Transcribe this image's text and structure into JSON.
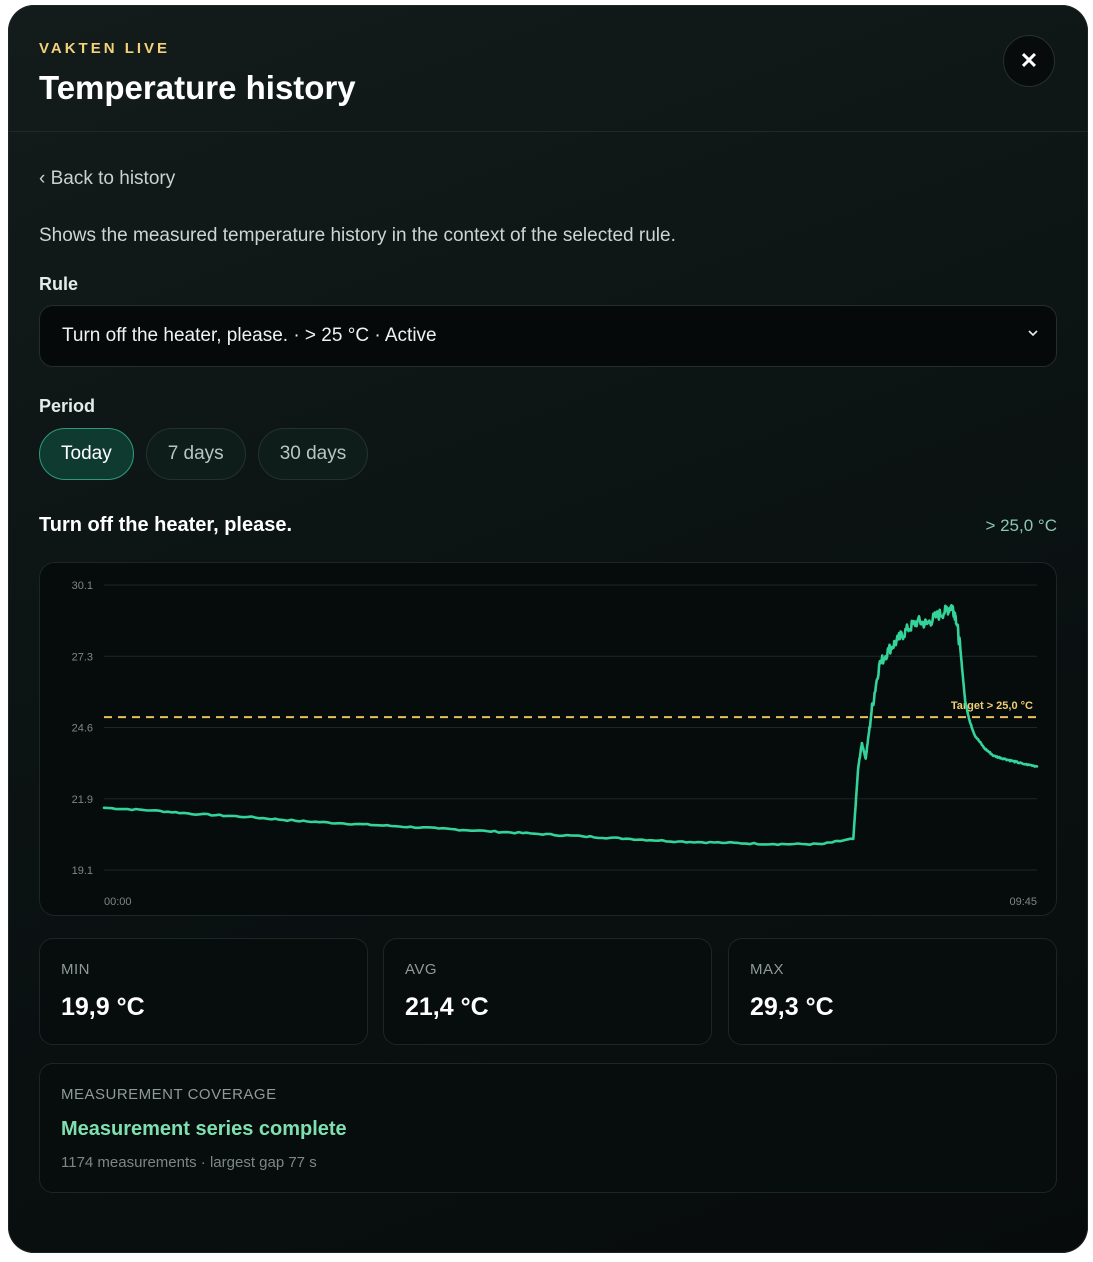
{
  "header": {
    "eyebrow": "VAKTEN LIVE",
    "title": "Temperature history",
    "close_symbol": "✕"
  },
  "back_link": "‹ Back to history",
  "description": "Shows the measured temperature history in the context of the selected rule.",
  "rule": {
    "label": "Rule",
    "selected": "Turn off the heater, please. · > 25 °C · Active"
  },
  "period": {
    "label": "Period",
    "options": [
      "Today",
      "7 days",
      "30 days"
    ],
    "active_index": 0
  },
  "chart_header": {
    "title": "Turn off the heater, please.",
    "target": "> 25,0 °C"
  },
  "chart_data": {
    "type": "line",
    "title": "",
    "x_tick_labels": [
      "00:00",
      "09:45"
    ],
    "x_range_hours": [
      0,
      9.75
    ],
    "y_ticks": [
      "30.1",
      "27.3",
      "24.6",
      "21.9",
      "19.1"
    ],
    "ylim": [
      19.1,
      30.1
    ],
    "grid": true,
    "threshold": {
      "value": 25.0,
      "label": "Target > 25,0 °C"
    },
    "series": [
      {
        "points_hours_celsius": [
          [
            0.0,
            21.5
          ],
          [
            0.5,
            21.4
          ],
          [
            1.0,
            21.25
          ],
          [
            1.5,
            21.15
          ],
          [
            2.0,
            21.0
          ],
          [
            2.5,
            20.9
          ],
          [
            3.0,
            20.8
          ],
          [
            3.5,
            20.7
          ],
          [
            4.0,
            20.6
          ],
          [
            4.5,
            20.5
          ],
          [
            5.0,
            20.4
          ],
          [
            5.5,
            20.3
          ],
          [
            6.0,
            20.2
          ],
          [
            6.5,
            20.15
          ],
          [
            7.0,
            20.1
          ],
          [
            7.5,
            20.1
          ],
          [
            7.83,
            20.3
          ],
          [
            7.88,
            23.0
          ],
          [
            7.92,
            24.0
          ],
          [
            7.96,
            23.4
          ],
          [
            8.02,
            25.2
          ],
          [
            8.1,
            27.0
          ],
          [
            8.2,
            27.6
          ],
          [
            8.3,
            28.0
          ],
          [
            8.4,
            28.4
          ],
          [
            8.5,
            28.7
          ],
          [
            8.6,
            28.6
          ],
          [
            8.7,
            28.9
          ],
          [
            8.8,
            29.1
          ],
          [
            8.86,
            29.3
          ],
          [
            8.9,
            28.9
          ],
          [
            8.95,
            27.6
          ],
          [
            9.0,
            25.6
          ],
          [
            9.05,
            24.8
          ],
          [
            9.1,
            24.3
          ],
          [
            9.2,
            23.8
          ],
          [
            9.3,
            23.5
          ],
          [
            9.4,
            23.4
          ],
          [
            9.5,
            23.3
          ],
          [
            9.6,
            23.2
          ],
          [
            9.75,
            23.1
          ]
        ]
      }
    ]
  },
  "stats": [
    {
      "label": "MIN",
      "value": "19,9 °C"
    },
    {
      "label": "AVG",
      "value": "21,4 °C"
    },
    {
      "label": "MAX",
      "value": "29,3 °C"
    }
  ],
  "coverage": {
    "label": "MEASUREMENT COVERAGE",
    "status": "Measurement series complete",
    "detail": "1174 measurements · largest gap 77 s"
  },
  "colors": {
    "accent": "#34d399",
    "threshold": "#e8c15e",
    "eyebrow": "#f2d27a"
  }
}
